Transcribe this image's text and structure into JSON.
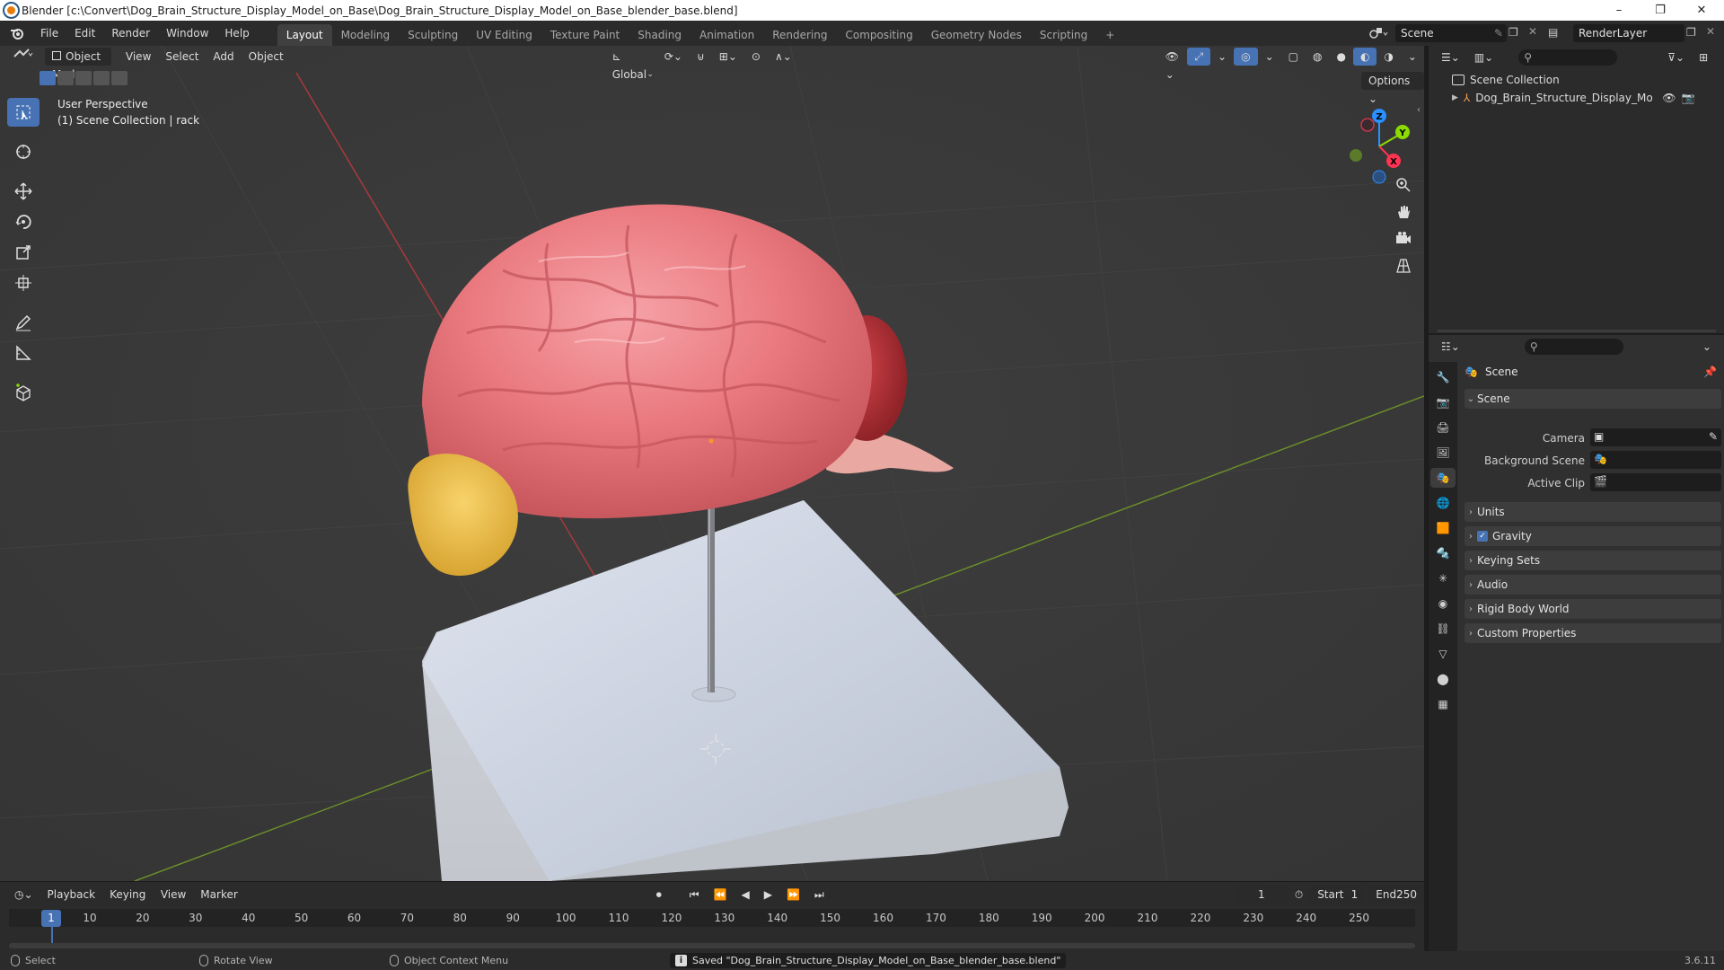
{
  "window": {
    "title": "Blender [c:\\Convert\\Dog_Brain_Structure_Display_Model_on_Base\\Dog_Brain_Structure_Display_Model_on_Base_blender_base.blend]",
    "minimize_glyph": "–",
    "maximize_glyph": "❐",
    "close_glyph": "✕"
  },
  "menubar": {
    "menus": [
      "File",
      "Edit",
      "Render",
      "Window",
      "Help"
    ],
    "workspaces": [
      "Layout",
      "Modeling",
      "Sculpting",
      "UV Editing",
      "Texture Paint",
      "Shading",
      "Animation",
      "Rendering",
      "Compositing",
      "Geometry Nodes",
      "Scripting"
    ],
    "active_workspace": "Layout",
    "add_workspace": "+",
    "scene_name": "Scene",
    "view_layer": "RenderLayer"
  },
  "viewport": {
    "mode": "Object Mode",
    "menus": [
      "View",
      "Select",
      "Add",
      "Object"
    ],
    "transform_orientation": "Global",
    "options_label": "Options",
    "view_name": "User Perspective",
    "collection_info": "(1) Scene Collection | rack",
    "gizmo_axes": {
      "x": "X",
      "y": "Y",
      "z": "Z"
    }
  },
  "outliner": {
    "root": "Scene Collection",
    "items": [
      {
        "label": "Dog_Brain_Structure_Display_Model_on"
      }
    ]
  },
  "properties": {
    "context_title": "Scene",
    "panel_title": "Scene",
    "fields": [
      {
        "label": "Camera"
      },
      {
        "label": "Background Scene"
      },
      {
        "label": "Active Clip"
      }
    ],
    "collapsed_panels": [
      "Units",
      "Gravity",
      "Keying Sets",
      "Audio",
      "Rigid Body World",
      "Custom Properties"
    ],
    "gravity_enabled": true
  },
  "timeline": {
    "menus": [
      "Playback",
      "Keying",
      "View",
      "Marker"
    ],
    "current_frame": "1",
    "start_label": "Start",
    "start": "1",
    "end_label": "End",
    "end": "250",
    "ticks": [
      "10",
      "20",
      "30",
      "40",
      "50",
      "60",
      "70",
      "80",
      "90",
      "100",
      "110",
      "120",
      "130",
      "140",
      "150",
      "160",
      "170",
      "180",
      "190",
      "200",
      "210",
      "220",
      "230",
      "240",
      "250"
    ],
    "playhead_label": "1"
  },
  "statusbar": {
    "select": "Select",
    "rotate": "Rotate View",
    "context_menu": "Object Context Menu",
    "message": "Saved \"Dog_Brain_Structure_Display_Model_on_Base_blender_base.blend\"",
    "version": "3.6.11"
  },
  "colors": {
    "accent": "#4772b3",
    "axis_x": "#ff3352",
    "axis_y": "#8bdc00",
    "axis_z": "#2890ff"
  }
}
